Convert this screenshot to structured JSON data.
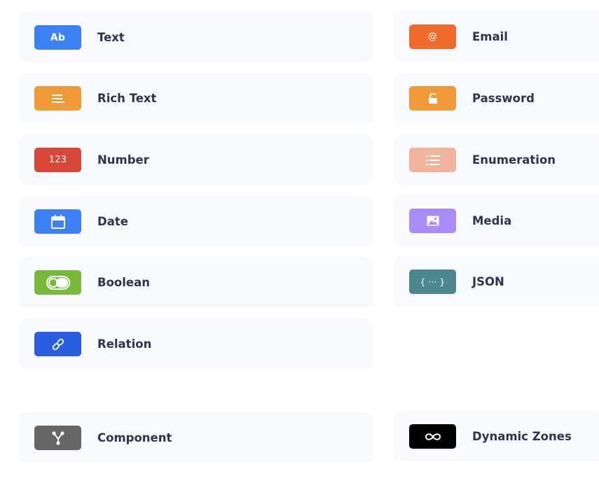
{
  "field_types": [
    {
      "label": "Text",
      "icon": "text-icon",
      "badge_text": "Ab",
      "color": "#3c82f6"
    },
    {
      "label": "Email",
      "icon": "at-icon",
      "badge_text": "@",
      "color": "#f06a2e"
    },
    {
      "label": "Rich Text",
      "icon": "paragraph-icon",
      "badge_text": "",
      "color": "#f19a3a"
    },
    {
      "label": "Password",
      "icon": "lock-icon",
      "badge_text": "",
      "color": "#f19a3a"
    },
    {
      "label": "Number",
      "icon": "number-icon",
      "badge_text": "123",
      "color": "#d9473a"
    },
    {
      "label": "Enumeration",
      "icon": "list-icon",
      "badge_text": "",
      "color": "#f0b49d"
    },
    {
      "label": "Date",
      "icon": "calendar-icon",
      "badge_text": "",
      "color": "#3c82f6"
    },
    {
      "label": "Media",
      "icon": "image-icon",
      "badge_text": "",
      "color": "#a98cf7"
    },
    {
      "label": "Boolean",
      "icon": "toggle-icon",
      "badge_text": "",
      "color": "#77b93a"
    },
    {
      "label": "JSON",
      "icon": "braces-icon",
      "badge_text": "{ ··· }",
      "color": "#4c8791"
    },
    {
      "label": "Relation",
      "icon": "link-icon",
      "badge_text": "",
      "color": "#2a5ee0"
    },
    {
      "label": "Component",
      "icon": "component-icon",
      "badge_text": "",
      "color": "#666666"
    },
    {
      "label": "Dynamic Zones",
      "icon": "infinity-icon",
      "badge_text": "",
      "color": "#000000"
    }
  ]
}
